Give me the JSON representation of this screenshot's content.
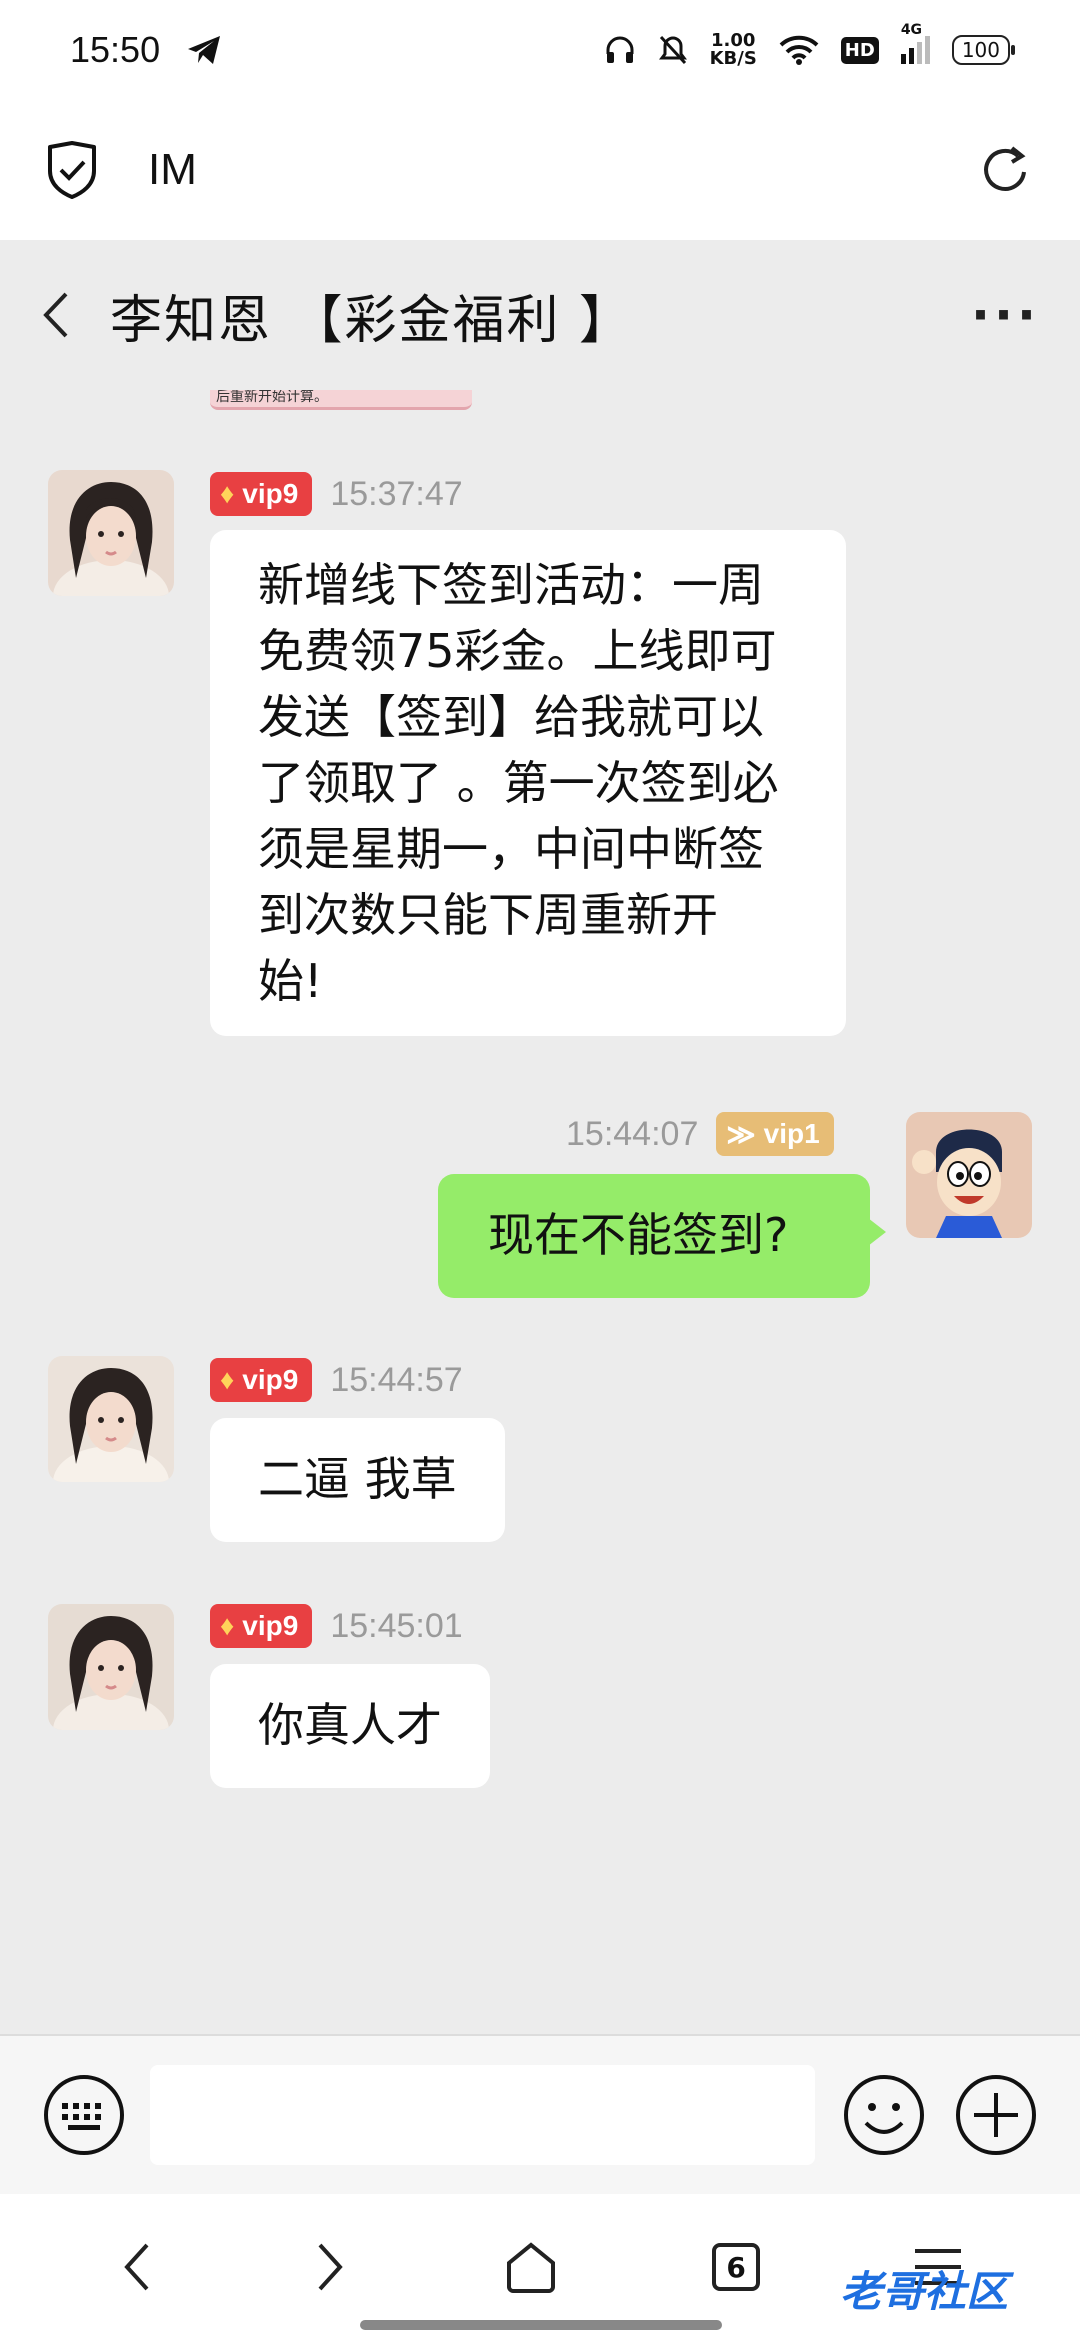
{
  "status_bar": {
    "time": "15:50",
    "net_speed_value": "1.00",
    "net_speed_unit": "KB/S",
    "hd": "HD",
    "signal": "4G",
    "battery": "100"
  },
  "app_bar": {
    "title": "IM"
  },
  "chat_header": {
    "name": "李知恩 【彩金福利 】",
    "more": "···"
  },
  "partial_image_text": "后重新开始计算。",
  "messages": [
    {
      "side": "left",
      "vip": "vip9",
      "time": "15:37:47",
      "lines": [
        "新增线下签到活动：一周",
        "免费领75彩金。上线即可",
        "发送【签到】给我就可以",
        "了领取了 。第一次签到必",
        "须是星期一，中间中断签",
        "到次数只能下周重新开",
        "始!"
      ]
    },
    {
      "side": "right",
      "vip": "vip1",
      "time": "15:44:07",
      "text": "现在不能签到?"
    },
    {
      "side": "left",
      "vip": "vip9",
      "time": "15:44:57",
      "text": "二逼 我草"
    },
    {
      "side": "left",
      "vip": "vip9",
      "time": "15:45:01",
      "text": "你真人才"
    }
  ],
  "input_bar": {
    "placeholder": ""
  },
  "nav_bar": {
    "tab_count": "6"
  },
  "watermark": "老哥社区",
  "colors": {
    "vip_red": "#e84042",
    "vip_gold": "#e7bd76",
    "my_bubble": "#95ec69",
    "chat_bg": "#ececec"
  }
}
